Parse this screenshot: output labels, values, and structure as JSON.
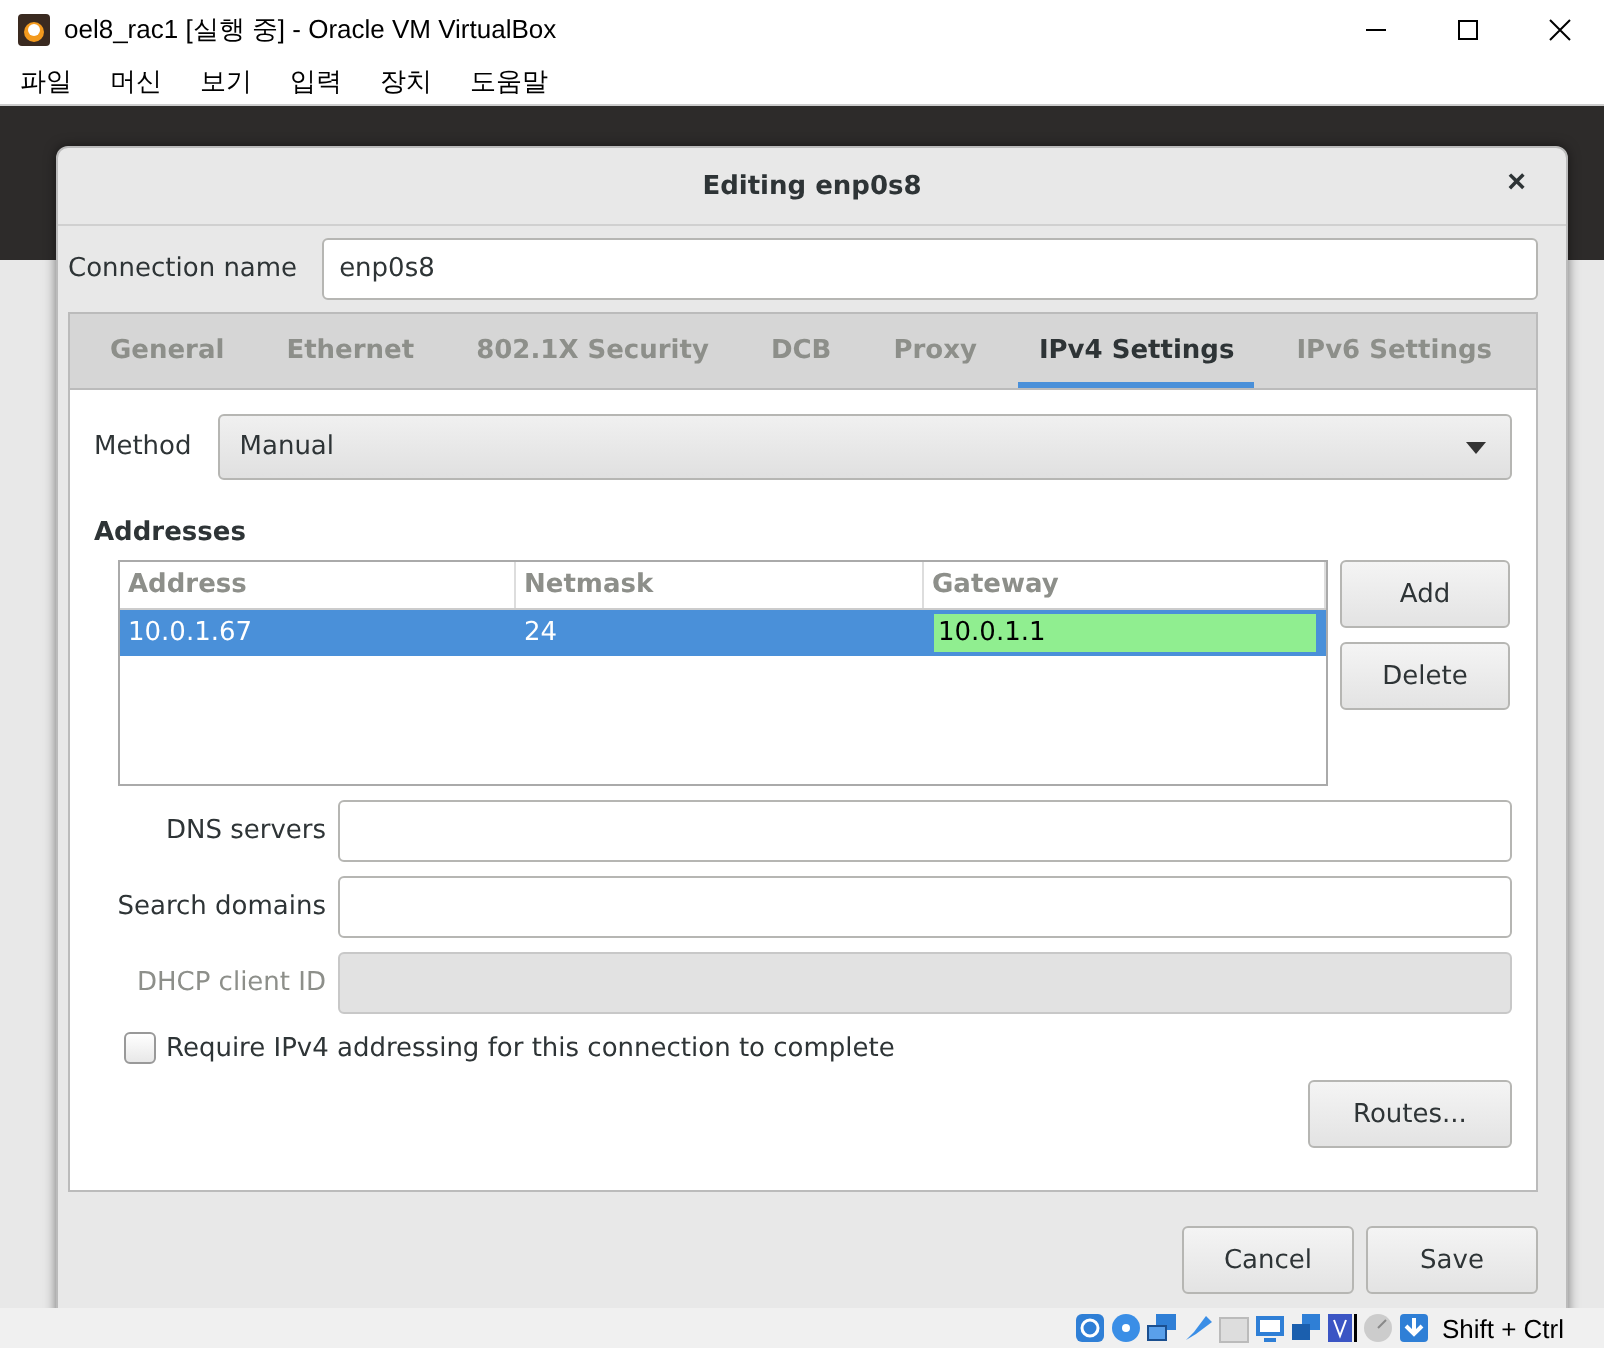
{
  "window": {
    "title": "oel8_rac1 [실행 중] - Oracle VM VirtualBox"
  },
  "menu": [
    "파일",
    "머신",
    "보기",
    "입력",
    "장치",
    "도움말"
  ],
  "dialog": {
    "title": "Editing enp0s8",
    "close": "×",
    "connection_name": {
      "label": "Connection name",
      "value": "enp0s8"
    },
    "tabs": [
      {
        "label": "General",
        "selected": false
      },
      {
        "label": "Ethernet",
        "selected": false
      },
      {
        "label": "802.1X Security",
        "selected": false
      },
      {
        "label": "DCB",
        "selected": false
      },
      {
        "label": "Proxy",
        "selected": false
      },
      {
        "label": "IPv4 Settings",
        "selected": true
      },
      {
        "label": "IPv6 Settings",
        "selected": false
      }
    ],
    "method": {
      "label": "Method",
      "value": "Manual"
    },
    "addresses": {
      "title": "Addresses",
      "columns": [
        "Address",
        "Netmask",
        "Gateway"
      ],
      "rows": [
        {
          "selected": true,
          "cells": [
            {
              "text": "10.0.1.67",
              "editing": false
            },
            {
              "text": "24",
              "editing": false
            },
            {
              "text": "10.0.1.1",
              "editing": true
            }
          ]
        }
      ],
      "buttons": [
        "Add",
        "Delete"
      ]
    },
    "fields": [
      {
        "label": "DNS servers",
        "disabled": false
      },
      {
        "label": "Search domains",
        "disabled": false
      },
      {
        "label": "DHCP client ID",
        "disabled": true
      }
    ],
    "require": {
      "label": "Require IPv4 addressing for this connection to complete",
      "checked": false
    },
    "routes_button": "Routes...",
    "buttons": [
      "Cancel",
      "Save"
    ]
  },
  "status_bar": {
    "host_key": "Shift + Ctrl"
  }
}
